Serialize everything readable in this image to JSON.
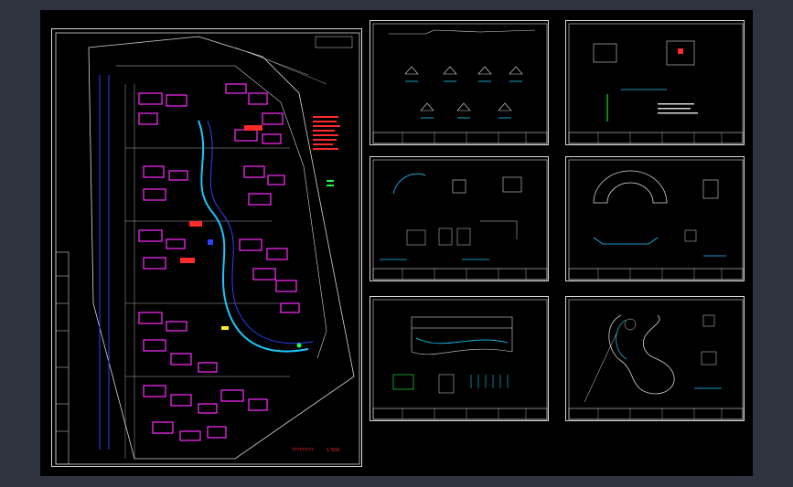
{
  "canvas": {
    "background": "#000000",
    "frame": "#2f3340"
  },
  "colors": {
    "line": "#d8d8d8",
    "building": "#ff2bff",
    "water": "#18c8ff",
    "road_edge": "#3040ff",
    "annotation": "#ff2a2a",
    "accent_green": "#22ff44",
    "yellow": "#ffee22"
  },
  "main_plan": {
    "title": "?????????",
    "scale": "1:500"
  },
  "sheets": [
    {
      "id": "sheet-1",
      "kind": "profile-and-details"
    },
    {
      "id": "sheet-2",
      "kind": "equipment-details"
    },
    {
      "id": "sheet-3",
      "kind": "pipe-system-details"
    },
    {
      "id": "sheet-4",
      "kind": "pool-section-details"
    },
    {
      "id": "sheet-5",
      "kind": "bridge-elevation-details"
    },
    {
      "id": "sheet-6",
      "kind": "fountain-plan-details"
    }
  ]
}
